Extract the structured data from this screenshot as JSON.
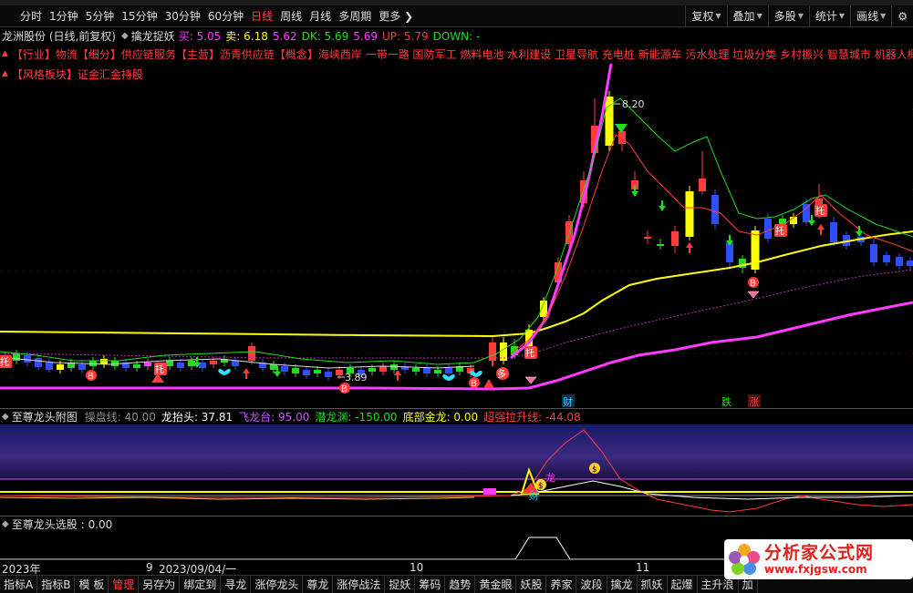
{
  "toolbar": {
    "periods": [
      {
        "label": "分时",
        "active": false
      },
      {
        "label": "1分钟",
        "active": false
      },
      {
        "label": "5分钟",
        "active": false
      },
      {
        "label": "15分钟",
        "active": false
      },
      {
        "label": "30分钟",
        "active": false
      },
      {
        "label": "60分钟",
        "active": false
      },
      {
        "label": "日线",
        "active": true
      },
      {
        "label": "周线",
        "active": false
      },
      {
        "label": "月线",
        "active": false
      },
      {
        "label": "多周期",
        "active": false
      },
      {
        "label": "更多 ❯",
        "active": false
      }
    ],
    "right_buttons": [
      "复权",
      "叠加",
      "多股",
      "统计",
      "画线"
    ],
    "gear_icon": "gear-icon"
  },
  "main_chart": {
    "title": "龙洲股份 (日线,前复权)",
    "indicator_name": "擒龙捉妖",
    "values": [
      {
        "label": "买: 5.05",
        "color": "#ff3bff"
      },
      {
        "label": "卖: 6.18",
        "color": "#ffff00"
      },
      {
        "label": "5.62",
        "color": "#ff3bff"
      },
      {
        "label": "DK: 5.69",
        "color": "#22dd22"
      },
      {
        "label": "5.69",
        "color": "#ff3bff"
      },
      {
        "label": "UP: 5.79",
        "color": "#ff3b3b"
      },
      {
        "label": "DOWN: -",
        "color": "#22dd22"
      }
    ],
    "tags_line1": "【行业】物流【细分】供应链服务【主营】沥青供应链【概念】海峡西岸 一带一路 国防军工 燃料电池 水利建设 卫星导航 充电桩 新能源车 污水处理 垃圾分类 乡村振兴 智慧城市 机器人概",
    "tags_line2": "【风格板块】证金汇金持股",
    "labels": {
      "high_price": "8.20",
      "low_price": "3.89",
      "cai": "财",
      "die": "跌",
      "zhang": "涨",
      "tuo": "托",
      "b": "B",
      "duo": "多"
    }
  },
  "sub1": {
    "title": "至尊龙头附图",
    "values": [
      {
        "label": "操盘线: 40.00",
        "color": "#888888"
      },
      {
        "label": "龙抬头: 37.81",
        "color": "#ffffff"
      },
      {
        "label": "飞龙台: 95.00",
        "color": "#cc55ff"
      },
      {
        "label": "潜龙渊: -150.00",
        "color": "#22dd22"
      },
      {
        "label": "底部金龙: 0.00",
        "color": "#ffff00"
      },
      {
        "label": "超强拉升线: -44.08",
        "color": "#ff3b3b"
      }
    ],
    "labels": {
      "cai": "财",
      "dragon": "龙"
    }
  },
  "sub2": {
    "title": "至尊龙头选股",
    "value": ": 0.00"
  },
  "time_axis": [
    "2023年",
    "9",
    "2023/09/04/一",
    "10",
    "11"
  ],
  "bottom_tabs": [
    {
      "label": "指标A",
      "active": false
    },
    {
      "label": "指标B",
      "active": false
    },
    {
      "label": "模 板",
      "active": false
    },
    {
      "label": "管理",
      "active": true
    },
    {
      "label": "另存为",
      "active": false
    },
    {
      "label": "绑定到",
      "active": false
    },
    {
      "label": "寻龙",
      "active": false
    },
    {
      "label": "涨停龙头",
      "active": false
    },
    {
      "label": "尊龙",
      "active": false
    },
    {
      "label": "涨停战法",
      "active": false
    },
    {
      "label": "捉妖",
      "active": false
    },
    {
      "label": "筹码",
      "active": false
    },
    {
      "label": "趋势",
      "active": false
    },
    {
      "label": "黄金眼",
      "active": false
    },
    {
      "label": "妖股",
      "active": false
    },
    {
      "label": "养家",
      "active": false
    },
    {
      "label": "波段",
      "active": false
    },
    {
      "label": "擒龙",
      "active": false
    },
    {
      "label": "抓妖",
      "active": false
    },
    {
      "label": "起爆",
      "active": false
    },
    {
      "label": "主升浪",
      "active": false
    },
    {
      "label": "加",
      "active": false
    }
  ],
  "watermark": {
    "cn": "分析家公式网",
    "url": "www.fxjgsw.com",
    "logo_icon": "flower-logo-icon"
  },
  "colors": {
    "up": "#ff3b3b",
    "down": "#2f4fff",
    "yellow": "#ffff00",
    "magenta": "#ff3bff",
    "green": "#22dd22",
    "bg": "#000000"
  }
}
